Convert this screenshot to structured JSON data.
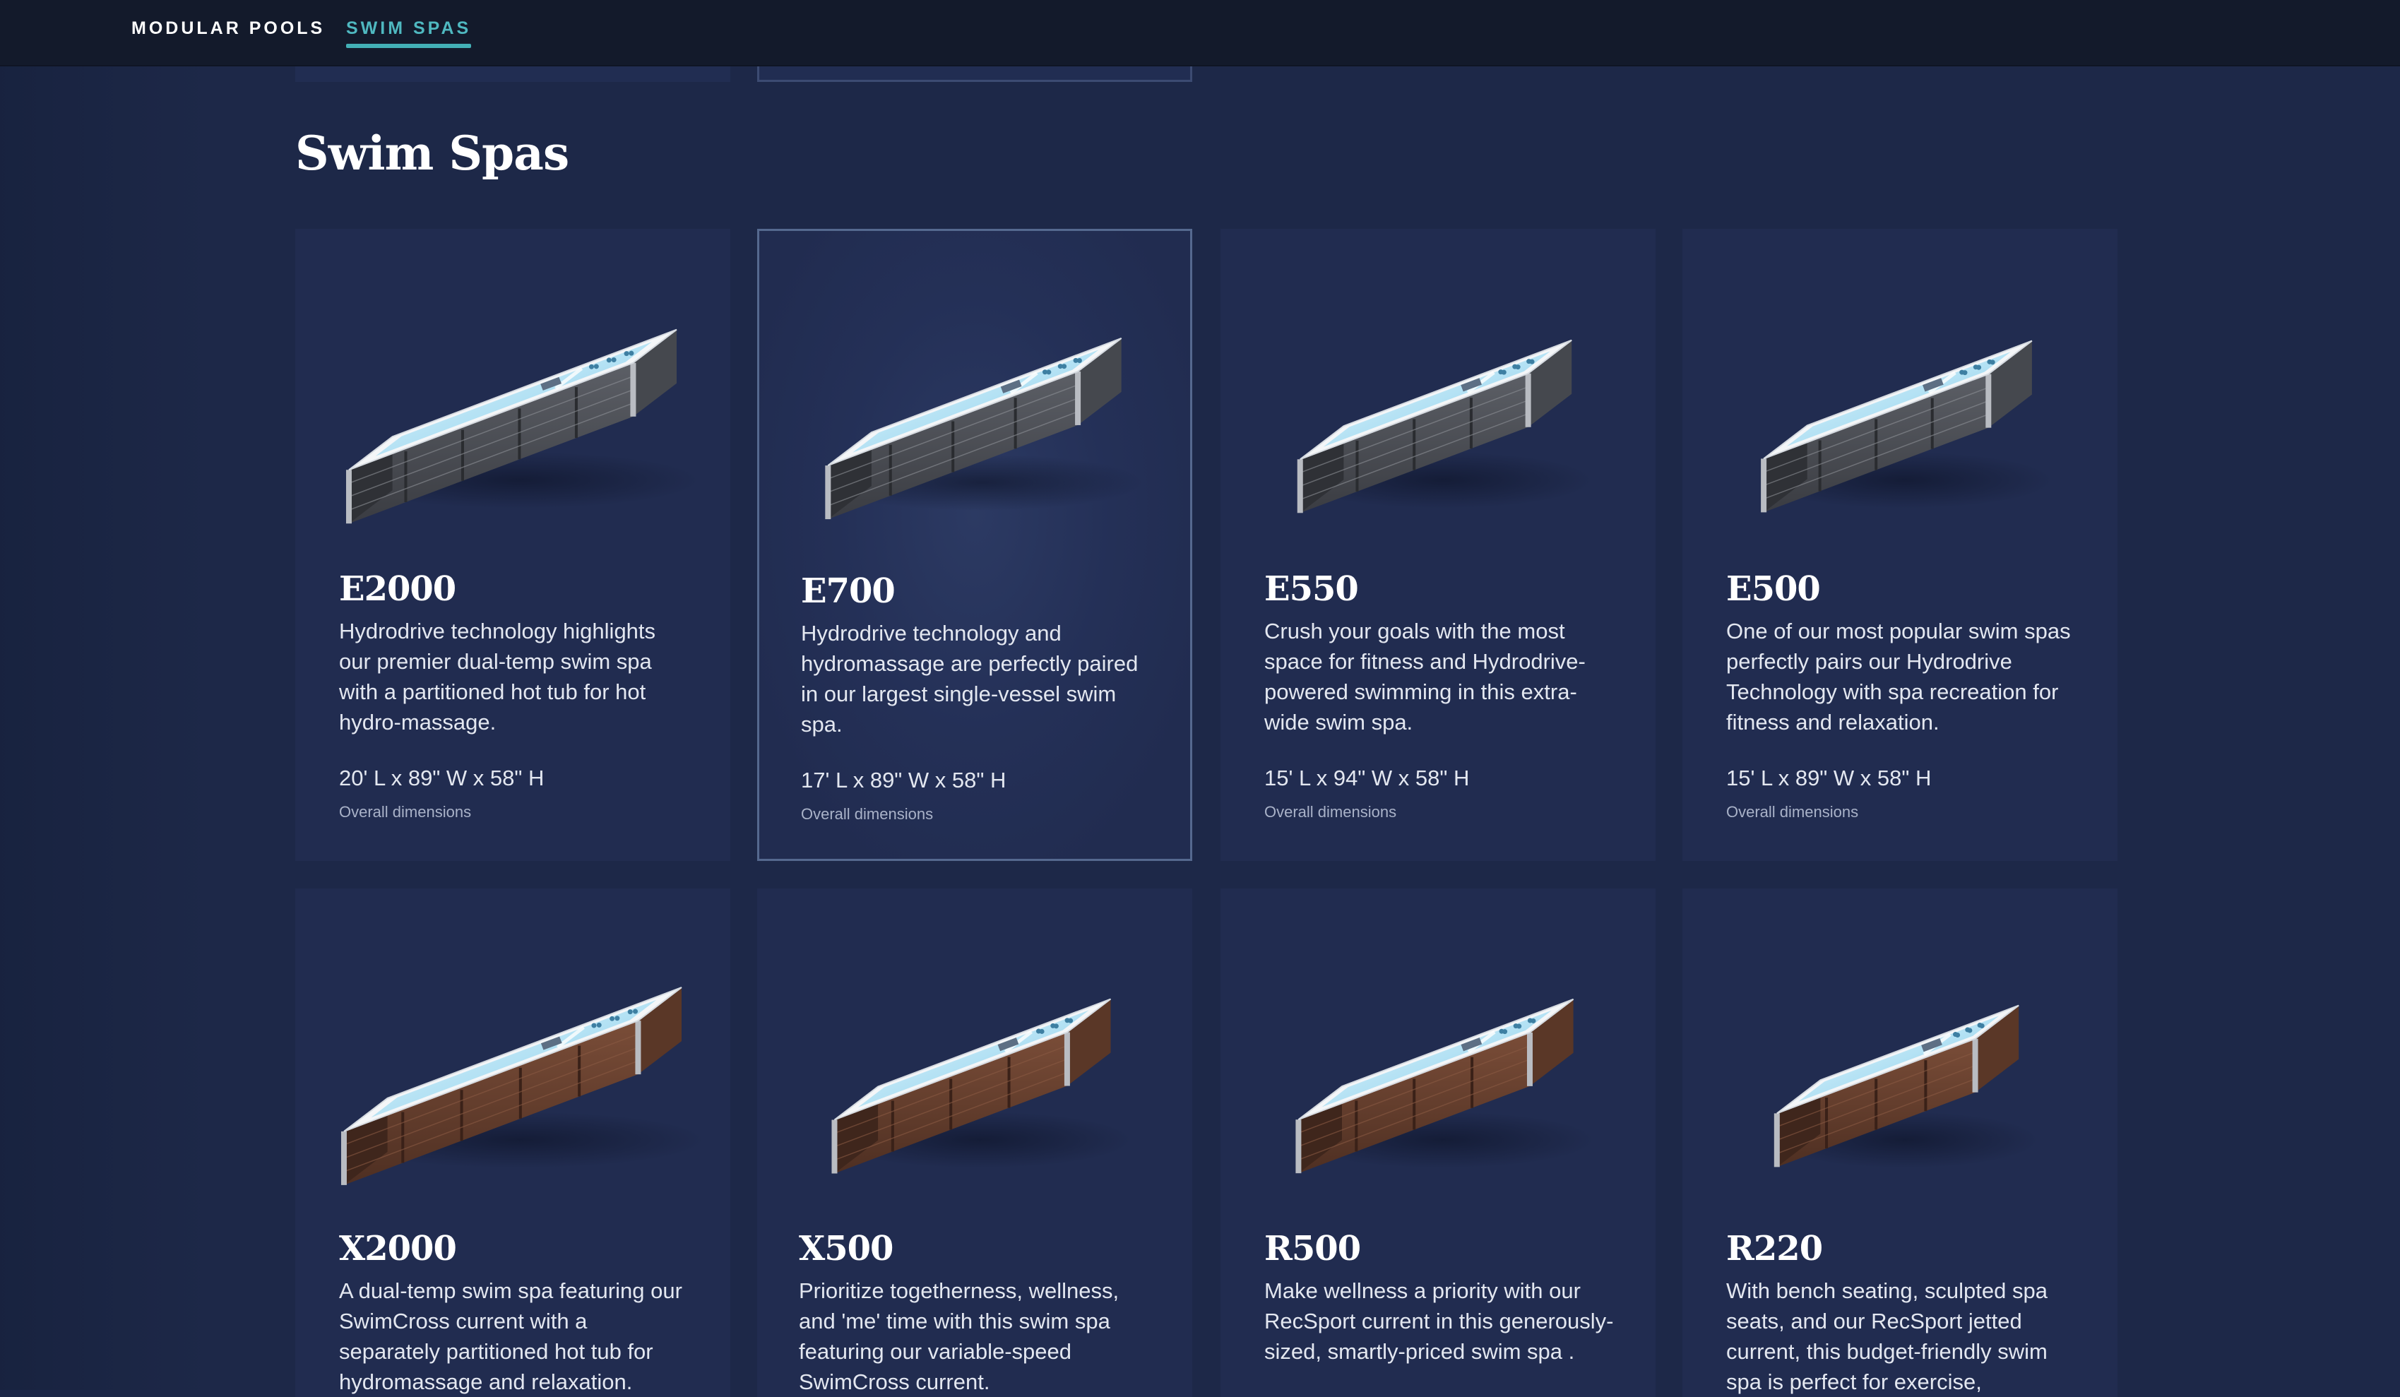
{
  "nav": {
    "items": [
      {
        "label": "MODULAR POOLS",
        "active": false
      },
      {
        "label": "SWIM SPAS",
        "active": true
      }
    ]
  },
  "section": {
    "title": "Swim Spas"
  },
  "colors": {
    "background": "#1d2848",
    "card": "#212c50",
    "nav_background": "#131a2b",
    "accent": "#4fb8c0"
  },
  "products": [
    {
      "name": "E2000",
      "description": "Hydrodrive technology highlights our premier dual-temp swim spa with a partitioned hot tub for hot hydro-massage.",
      "dimensions": "20' L x 89\" W x 58\" H",
      "dimensions_label": "Overall dimensions",
      "cabinet": "gray"
    },
    {
      "name": "E700",
      "description": "Hydrodrive technology and hydromassage are perfectly paired in our largest single-vessel swim spa.",
      "dimensions": "17' L x 89\" W x 58\" H",
      "dimensions_label": "Overall dimensions",
      "cabinet": "gray"
    },
    {
      "name": "E550",
      "description": "Crush your goals with the most space for fitness and Hydrodrive-powered swimming in this extra-wide swim spa.",
      "dimensions": "15' L x 94\" W x 58\" H",
      "dimensions_label": "Overall dimensions",
      "cabinet": "gray"
    },
    {
      "name": "E500",
      "description": "One of our most popular swim spas perfectly pairs our Hydrodrive Technology with spa recreation for fitness and relaxation.",
      "dimensions": "15' L x 89\" W x 58\" H",
      "dimensions_label": "Overall dimensions",
      "cabinet": "gray"
    },
    {
      "name": "X2000",
      "description": "A dual-temp swim spa featuring our SwimCross current with a separately partitioned hot tub for hydromassage and relaxation.",
      "dimensions": "",
      "dimensions_label": "",
      "cabinet": "brown"
    },
    {
      "name": "X500",
      "description": "Prioritize togetherness, wellness, and 'me' time with this swim spa featuring our variable-speed SwimCross current.",
      "dimensions": "",
      "dimensions_label": "",
      "cabinet": "brown"
    },
    {
      "name": "R500",
      "description": "Make wellness a priority with our RecSport current in this generously-sized, smartly-priced swim spa .",
      "dimensions": "",
      "dimensions_label": "",
      "cabinet": "brown"
    },
    {
      "name": "R220",
      "description": "With bench seating, sculpted spa seats, and our RecSport jetted current, this budget-friendly swim spa is perfect for exercise,",
      "dimensions": "",
      "dimensions_label": "",
      "cabinet": "brown"
    }
  ]
}
